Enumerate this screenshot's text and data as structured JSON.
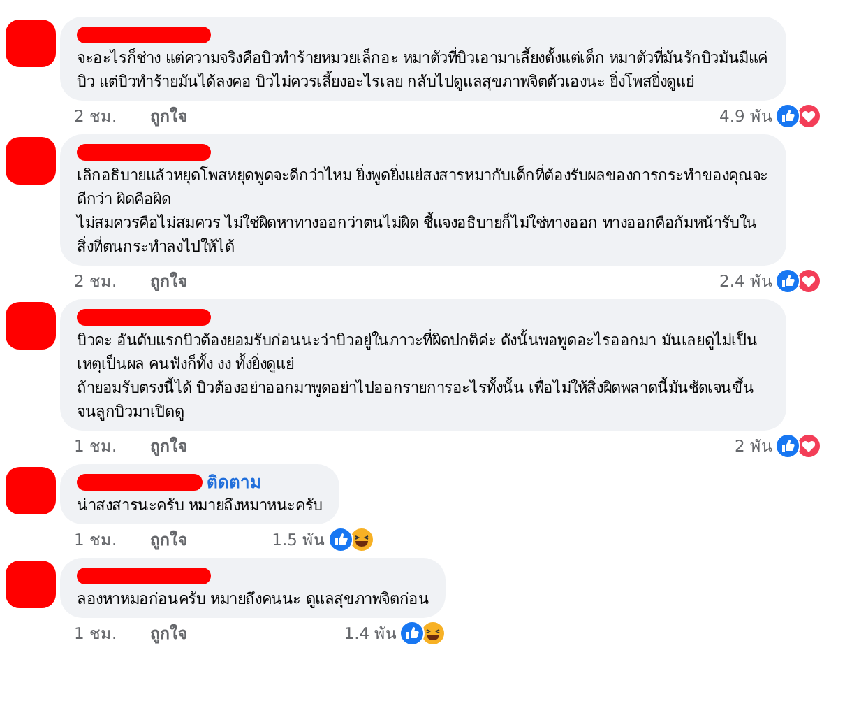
{
  "comments": [
    {
      "paragraphs": [
        "จะอะไรก็ช่าง แต่ความจริงคือบิวทำร้ายหมวยเล็กอะ หมาตัวที่บิวเอามาเลี้ยงตั้งแต่เด็ก หมาตัวที่มันรักบิวมันมีแค่บิว แต่บิวทำร้ายมันได้ลงคอ บิวไม่ควรเลี้ยงอะไรเลย กลับไปดูแลสุขภาพจิตตัวเองนะ ยิ่งโพสยิ่งดูแย่"
      ],
      "time": "2 ชม.",
      "like_label": "ถูกใจ",
      "reaction_count": "4.9 พัน",
      "reactions": [
        {
          "kind": "like"
        },
        {
          "kind": "love"
        }
      ]
    },
    {
      "paragraphs": [
        "เลิกอธิบายแล้วหยุดโพสหยุดพูดจะดีกว่าไหม ยิ่งพูดยิ่งแย่สงสารหมากับเด็กที่ต้องรับผลของการกระทำของคุณจะดีกว่า ผิดคือผิด",
        "ไม่สมควรคือไม่สมควร ไม่ใช่ผิดหาทางออกว่าตนไม่ผิด ชี้แจงอธิบายก็ไม่ใช่ทางออก ทางออกคือก้มหน้ารับในสิ่งที่ตนกระทำลงไปให้ได้"
      ],
      "time": "2 ชม.",
      "like_label": "ถูกใจ",
      "reaction_count": "2.4 พัน",
      "reactions": [
        {
          "kind": "like"
        },
        {
          "kind": "love"
        }
      ]
    },
    {
      "paragraphs": [
        "บิวคะ อันดับแรกบิวต้องยอมรับก่อนนะว่าบิวอยู่ในภาวะที่ผิดปกติค่ะ ดังนั้นพอพูดอะไรออกมา มันเลยดูไม่เป็นเหตุเป็นผล คนฟังก็ทั้ง งง ทั้งยิ่งดูแย่",
        "ถ้ายอมรับตรงนี้ได้ บิวต้องอย่าออกมาพูดอย่าไปออกรายการอะไรทั้งนั้น เพื่อไม่ให้สิ่งผิดพลาดนี้มันชัดเจนขึ้นจนลูกบิวมาเปิดดู"
      ],
      "time": "1 ชม.",
      "like_label": "ถูกใจ",
      "reaction_count": "2 พัน",
      "reactions": [
        {
          "kind": "like"
        },
        {
          "kind": "love"
        }
      ]
    },
    {
      "follow_label": "ติดตาม",
      "paragraphs": [
        "น่าสงสารนะครับ หมายถึงหมาหนะครับ"
      ],
      "time": "1 ชม.",
      "like_label": "ถูกใจ",
      "reaction_count": "1.5 พัน",
      "reactions": [
        {
          "kind": "like"
        },
        {
          "kind": "haha"
        }
      ]
    },
    {
      "paragraphs": [
        "ลองหาหมอก่อนครับ หมายถึงคนนะ ดูแลสุขภาพจิตก่อน"
      ],
      "time": "1 ชม.",
      "like_label": "ถูกใจ",
      "reaction_count": "1.4 พัน",
      "reactions": [
        {
          "kind": "like"
        },
        {
          "kind": "haha"
        }
      ]
    }
  ]
}
